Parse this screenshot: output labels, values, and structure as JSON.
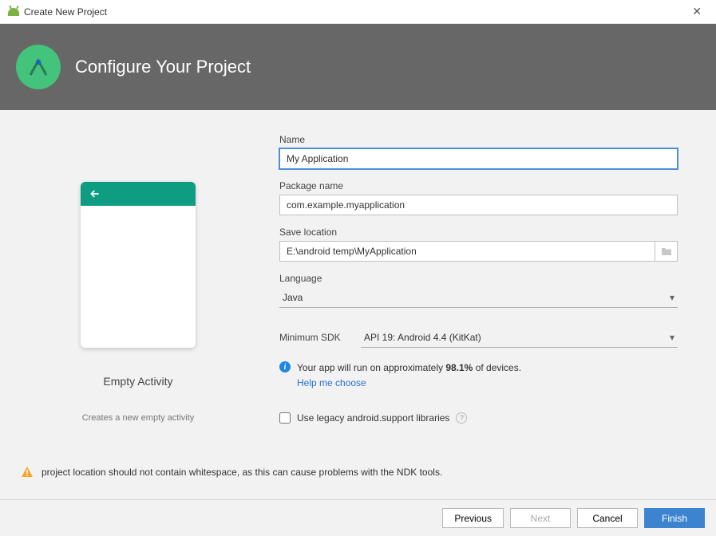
{
  "window": {
    "title": "Create New Project"
  },
  "header": {
    "title": "Configure Your Project"
  },
  "preview": {
    "title": "Empty Activity",
    "subtitle": "Creates a new empty activity"
  },
  "form": {
    "name_label": "Name",
    "name_value": "My Application",
    "package_label": "Package name",
    "package_value": "com.example.myapplication",
    "location_label": "Save location",
    "location_value": "E:\\android temp\\MyApplication",
    "language_label": "Language",
    "language_value": "Java",
    "minsdk_label": "Minimum SDK",
    "minsdk_value": "API 19: Android 4.4 (KitKat)",
    "info_prefix": "Your app will run on approximately ",
    "info_pct": "98.1%",
    "info_suffix": " of devices.",
    "info_link": "Help me choose",
    "legacy_label": "Use legacy android.support libraries"
  },
  "warning": "project location should not contain whitespace, as this can cause problems with the NDK tools.",
  "buttons": {
    "previous": "Previous",
    "next": "Next",
    "cancel": "Cancel",
    "finish": "Finish"
  }
}
